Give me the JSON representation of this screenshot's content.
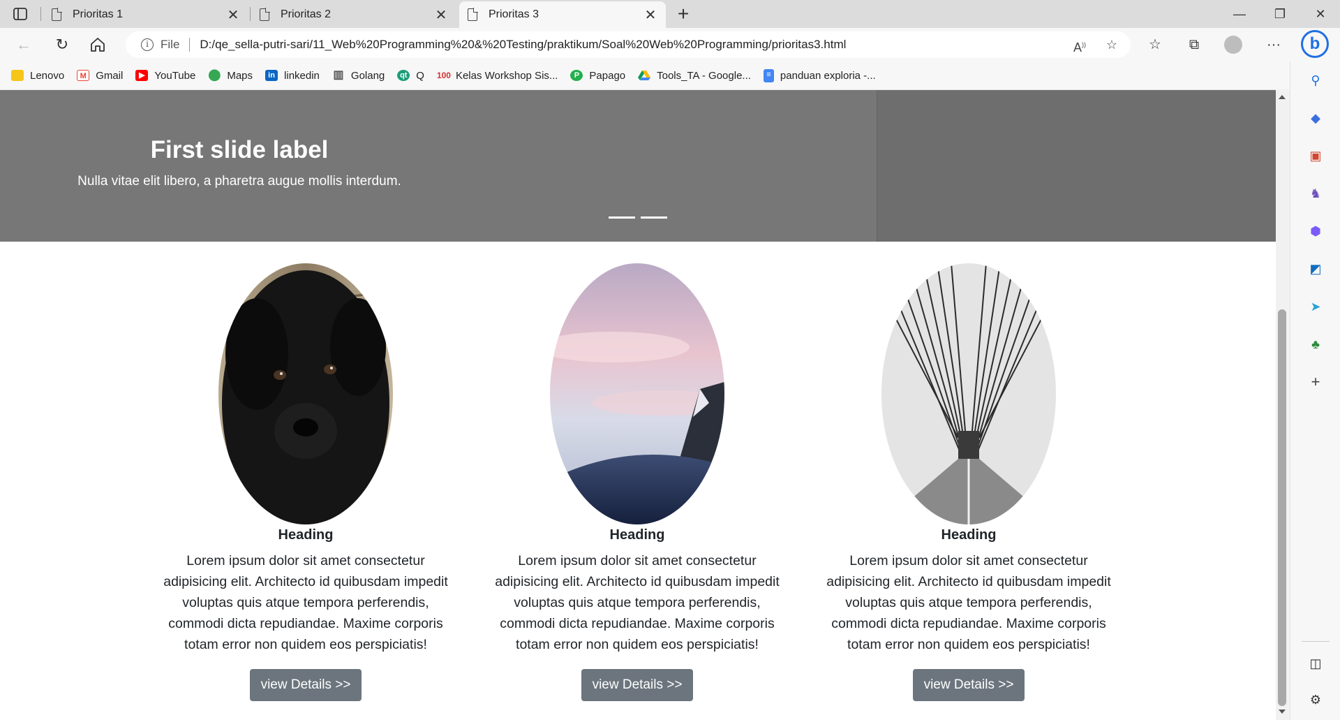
{
  "tabs": [
    {
      "title": "Prioritas 1",
      "active": false
    },
    {
      "title": "Prioritas 2",
      "active": false
    },
    {
      "title": "Prioritas 3",
      "active": true
    }
  ],
  "address_bar": {
    "scheme_label": "File",
    "url": "D:/qe_sella-putri-sari/11_Web%20Programming%20&%20Testing/praktikum/Soal%20Web%20Programming/prioritas3.html"
  },
  "bookmarks": [
    {
      "label": "Lenovo",
      "icon": "folder-icon",
      "color": "#f5c518"
    },
    {
      "label": "Gmail",
      "icon": "gmail-icon",
      "color": "#ea4335"
    },
    {
      "label": "YouTube",
      "icon": "youtube-icon",
      "color": "#ff0000"
    },
    {
      "label": "Maps",
      "icon": "maps-icon",
      "color": "#34a853"
    },
    {
      "label": "linkedin",
      "icon": "linkedin-icon",
      "color": "#0a66c2"
    },
    {
      "label": "Golang",
      "icon": "book-icon",
      "color": "#555555"
    },
    {
      "label": "Q",
      "icon": "qt-icon",
      "color": "#1b9e77"
    },
    {
      "label": "Kelas Workshop Sis...",
      "icon": "hundred-icon",
      "color": "#d32f2f"
    },
    {
      "label": "Papago",
      "icon": "papago-icon",
      "color": "#22b14c"
    },
    {
      "label": "Tools_TA - Google...",
      "icon": "drive-icon",
      "color": "#fbbc04"
    },
    {
      "label": "panduan exploria -...",
      "icon": "docs-icon",
      "color": "#4285f4"
    }
  ],
  "carousel": {
    "title": "First slide label",
    "caption": "Nulla vitae elit libero, a pharetra augue mollis interdum.",
    "indicator_count": 2
  },
  "cards": [
    {
      "image": "black-puppy",
      "heading": "Heading",
      "text": "Lorem ipsum dolor sit amet consectetur adipisicing elit. Architecto id quibusdam impedit voluptas quis atque tempora perferendis, commodi dicta repudiandae. Maxime corporis totam error non quidem eos perspiciatis!",
      "button": "view Details >>"
    },
    {
      "image": "pink-sky-mountain",
      "heading": "Heading",
      "text": "Lorem ipsum dolor sit amet consectetur adipisicing elit. Architecto id quibusdam impedit voluptas quis atque tempora perferendis, commodi dicta repudiandae. Maxime corporis totam error non quidem eos perspiciatis!",
      "button": "view Details >>"
    },
    {
      "image": "suspension-bridge",
      "heading": "Heading",
      "text": "Lorem ipsum dolor sit amet consectetur adipisicing elit. Architecto id quibusdam impedit voluptas quis atque tempora perferendis, commodi dicta repudiandae. Maxime corporis totam error non quidem eos perspiciatis!",
      "button": "view Details >>"
    }
  ],
  "colors": {
    "button_bg": "#6c757d",
    "carousel_bg": "#777777",
    "bing_blue": "#1f6fe5"
  }
}
